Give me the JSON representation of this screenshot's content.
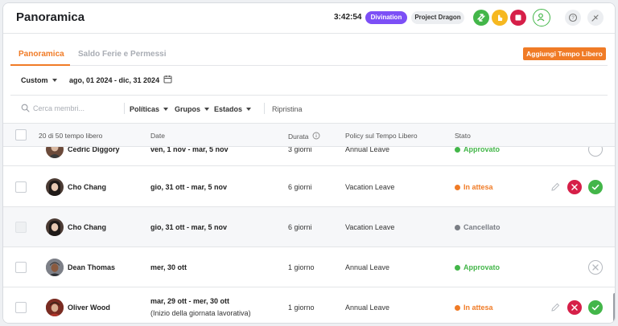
{
  "app": {
    "title": "Panoramica"
  },
  "topbar": {
    "timer": "3:42:54",
    "badge_primary": "Divination",
    "badge_secondary": "Project Dragon"
  },
  "tabs": [
    {
      "label": "Panoramica",
      "active": true
    },
    {
      "label": "Saldo Ferie e Permessi",
      "active": false
    }
  ],
  "add_button_label": "Aggiungi Tempo Libero",
  "filters": {
    "period": "Custom",
    "date_range": "ago, 01 2024 - dic, 31 2024",
    "search_placeholder": "Cerca membri...",
    "policies": "Políticas",
    "groups": "Grupos",
    "states": "Estados",
    "reset": "Ripristina"
  },
  "table": {
    "count_label": "20 di 50 tempo libero",
    "columns": {
      "date": "Date",
      "duration": "Durata",
      "policy": "Policy sul Tempo Libero",
      "status": "Stato"
    },
    "clipped_row": {
      "name": "Cedric Diggory",
      "dates": "ven, 1 nov - mar, 5 nov",
      "duration": "3 giorni",
      "policy": "Annual Leave",
      "status": "Approvato"
    },
    "rows": [
      {
        "name": "Cho Chang",
        "dates": "gio, 31 ott - mar, 5 nov",
        "note": "",
        "duration": "6 giorni",
        "policy": "Vacation Leave",
        "status": "In attesa"
      },
      {
        "name": "Cho Chang",
        "dates": "gio, 31 ott - mar, 5 nov",
        "note": "",
        "duration": "6 giorni",
        "policy": "Vacation Leave",
        "status": "Cancellato"
      },
      {
        "name": "Dean Thomas",
        "dates": "mer, 30 ott",
        "note": "",
        "duration": "1 giorno",
        "policy": "Annual Leave",
        "status": "Approvato"
      },
      {
        "name": "Oliver Wood",
        "dates": "mar, 29 ott - mer, 30 ott",
        "note": "(Inizio della giornata lavorativa)",
        "duration": "1 giorno",
        "policy": "Annual Leave",
        "status": "In attesa"
      }
    ]
  },
  "colors": {
    "accent": "#f07b26",
    "approved": "#43b649",
    "pending": "#f07b26",
    "cancelled": "#7a7e85",
    "reject": "#d61f48",
    "purple": "#7c4ff6"
  }
}
